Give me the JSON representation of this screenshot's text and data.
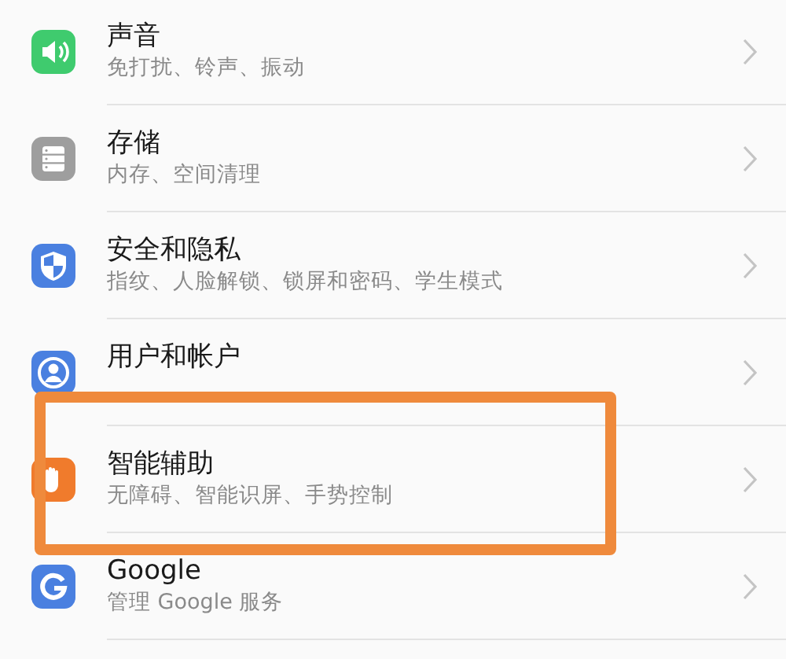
{
  "settings_items": [
    {
      "title": "声音",
      "subtitle": "免打扰、铃声、振动",
      "highlighted": false
    },
    {
      "title": "存储",
      "subtitle": "内存、空间清理",
      "highlighted": false
    },
    {
      "title": "安全和隐私",
      "subtitle": "指纹、人脸解锁、锁屏和密码、学生模式",
      "highlighted": false
    },
    {
      "title": "用户和帐户",
      "highlighted": false
    },
    {
      "title": "智能辅助",
      "subtitle": "无障碍、智能识屏、手势控制",
      "highlighted": true
    },
    {
      "title": "Google",
      "subtitle": "管理 Google 服务",
      "highlighted": false
    }
  ]
}
